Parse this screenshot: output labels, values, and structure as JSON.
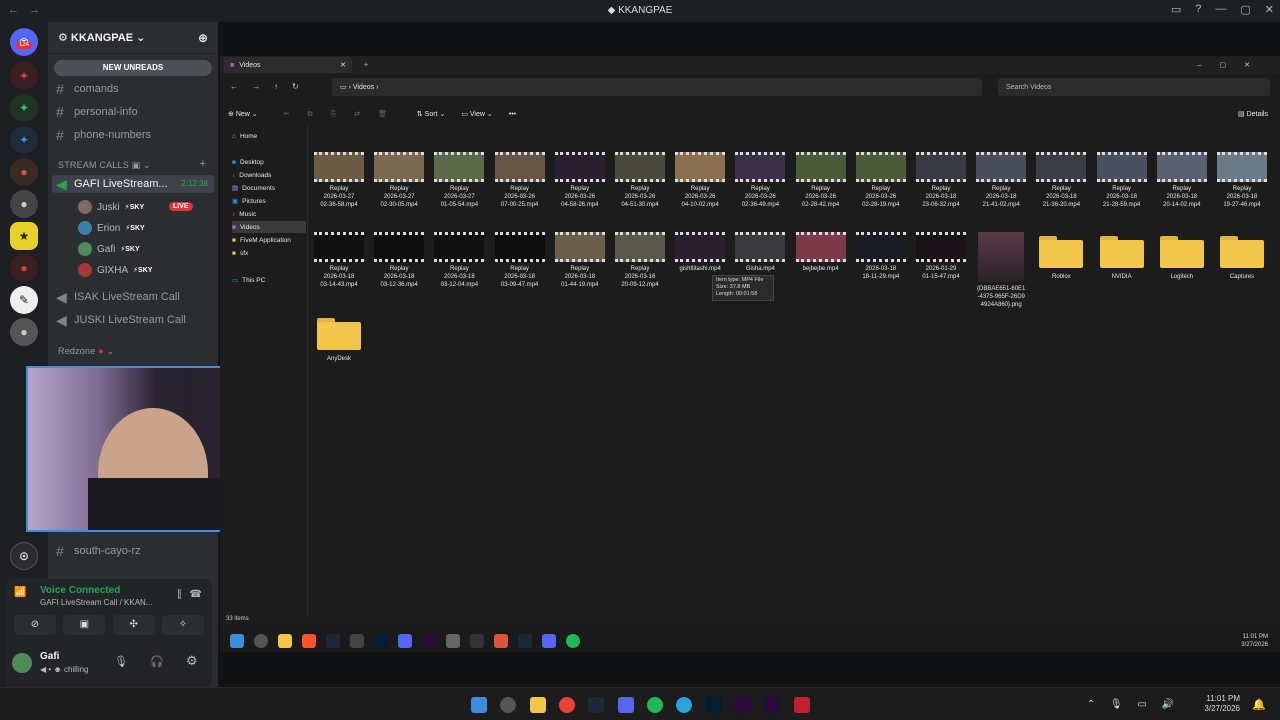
{
  "titlebar": {
    "title": "KKANGPAE",
    "back": "←",
    "forward": "→"
  },
  "server": {
    "name": "KKANGPAE",
    "badge": "124"
  },
  "channels": {
    "new_unreads": "NEW UNREADS",
    "text": [
      "comands",
      "personal-info",
      "phone-numbers"
    ],
    "stream_category": "STREAM CALLS",
    "active_call": {
      "name": "GAFI LiveStream...",
      "timer": "2:12:38"
    },
    "voice_users": [
      {
        "name": "Juski",
        "tag": "SKY",
        "live": "LIVE",
        "color": "#7b6b62"
      },
      {
        "name": "Erion",
        "tag": "SKY",
        "live": "",
        "color": "#3d7ea6"
      },
      {
        "name": "Gafi",
        "tag": "SKY",
        "live": "",
        "color": "#4b8c5a"
      },
      {
        "name": "GIXHA",
        "tag": "SKY",
        "live": "",
        "color": "#a33a3a"
      }
    ],
    "other_calls": [
      "ISAK LiveStream Call",
      "JUSKI LiveStream Call"
    ],
    "redzone_category": "Redzone",
    "bottom_channel": "south-cayo-rz"
  },
  "voice": {
    "status": "Voice Connected",
    "sub": "GAFI LiveStream Call / KKAN...",
    "user": "Gafi",
    "user_status": "chilling"
  },
  "explorer": {
    "tab": "Videos",
    "path": "Videos",
    "search_placeholder": "Search Videos",
    "toolbar": {
      "new": "New",
      "sort": "Sort",
      "view": "View",
      "details": "Details"
    },
    "nav": [
      "Home",
      "Desktop",
      "Downloads",
      "Documents",
      "Pictures",
      "Music",
      "Videos",
      "FiveM Application",
      "sfx",
      "This PC"
    ],
    "status": "33 items",
    "tooltip": [
      "Item type: MP4 File",
      "Size: 37.8 MB",
      "Length: 00:01:58"
    ],
    "row1": [
      [
        "Replay",
        "2026-03-27",
        "02-36-58.mp4"
      ],
      [
        "Replay",
        "2026-03-27",
        "02-30-05.mp4"
      ],
      [
        "Replay",
        "2026-03-27",
        "01-05-54.mp4"
      ],
      [
        "Replay",
        "2026-03-26",
        "07-00-25.mp4"
      ],
      [
        "Replay",
        "2026-03-26",
        "04-58-26.mp4"
      ],
      [
        "Replay",
        "2026-03-26",
        "04-51-30.mp4"
      ],
      [
        "Replay",
        "2026-03-26",
        "04-10-02.mp4"
      ],
      [
        "Replay",
        "2026-03-26",
        "02-36-49.mp4"
      ],
      [
        "Replay",
        "2026-03-26",
        "02-28-42.mp4"
      ],
      [
        "Replay",
        "2026-03-26",
        "02-28-19.mp4"
      ],
      [
        "Replay",
        "2026-03-18",
        "23-06-32.mp4"
      ],
      [
        "Replay",
        "2026-03-18",
        "21-41-02.mp4"
      ],
      [
        "Replay",
        "2026-03-18",
        "21-36-20.mp4"
      ],
      [
        "Replay",
        "2026-03-18",
        "21-28-59.mp4"
      ],
      [
        "Replay",
        "2026-03-18",
        "20-14-02.mp4"
      ],
      [
        "Replay",
        "2026-03-18",
        "19-27-46.mp4"
      ]
    ],
    "row2": [
      [
        "Replay",
        "2026-03-18",
        "03-14-43.mp4"
      ],
      [
        "Replay",
        "2026-03-18",
        "03-12-36.mp4"
      ],
      [
        "Replay",
        "2026-03-18",
        "03-12-04.mp4"
      ],
      [
        "Replay",
        "2026-03-18",
        "03-09-47.mp4"
      ],
      [
        "Replay",
        "2026-03-18",
        "01-44-19.mp4"
      ],
      [
        "Replay",
        "2026-03-16",
        "20-09-12.mp4"
      ],
      [
        "gishtlitashi.mp4",
        "",
        ""
      ],
      [
        "Gisha.mp4",
        "",
        ""
      ],
      [
        "bejbejbe.mp4",
        "",
        ""
      ],
      [
        "2026-03-18",
        "18-11-29.mp4",
        ""
      ],
      [
        "2026-01-29",
        "01-15-47.mp4",
        ""
      ],
      [
        "{DBBAE651-60E1",
        "-4375-965F-26D9",
        "4924A860}.png"
      ]
    ],
    "folders": [
      "Roblox",
      "NVIDIA",
      "Logitech",
      "Captures",
      "AnyDesk"
    ]
  },
  "clock": {
    "time": "11:01 PM",
    "date": "3/27/2026"
  },
  "colors": {
    "discord_green": "#23a55a",
    "accent": "#5865f2",
    "folder": "#f2c54b"
  }
}
